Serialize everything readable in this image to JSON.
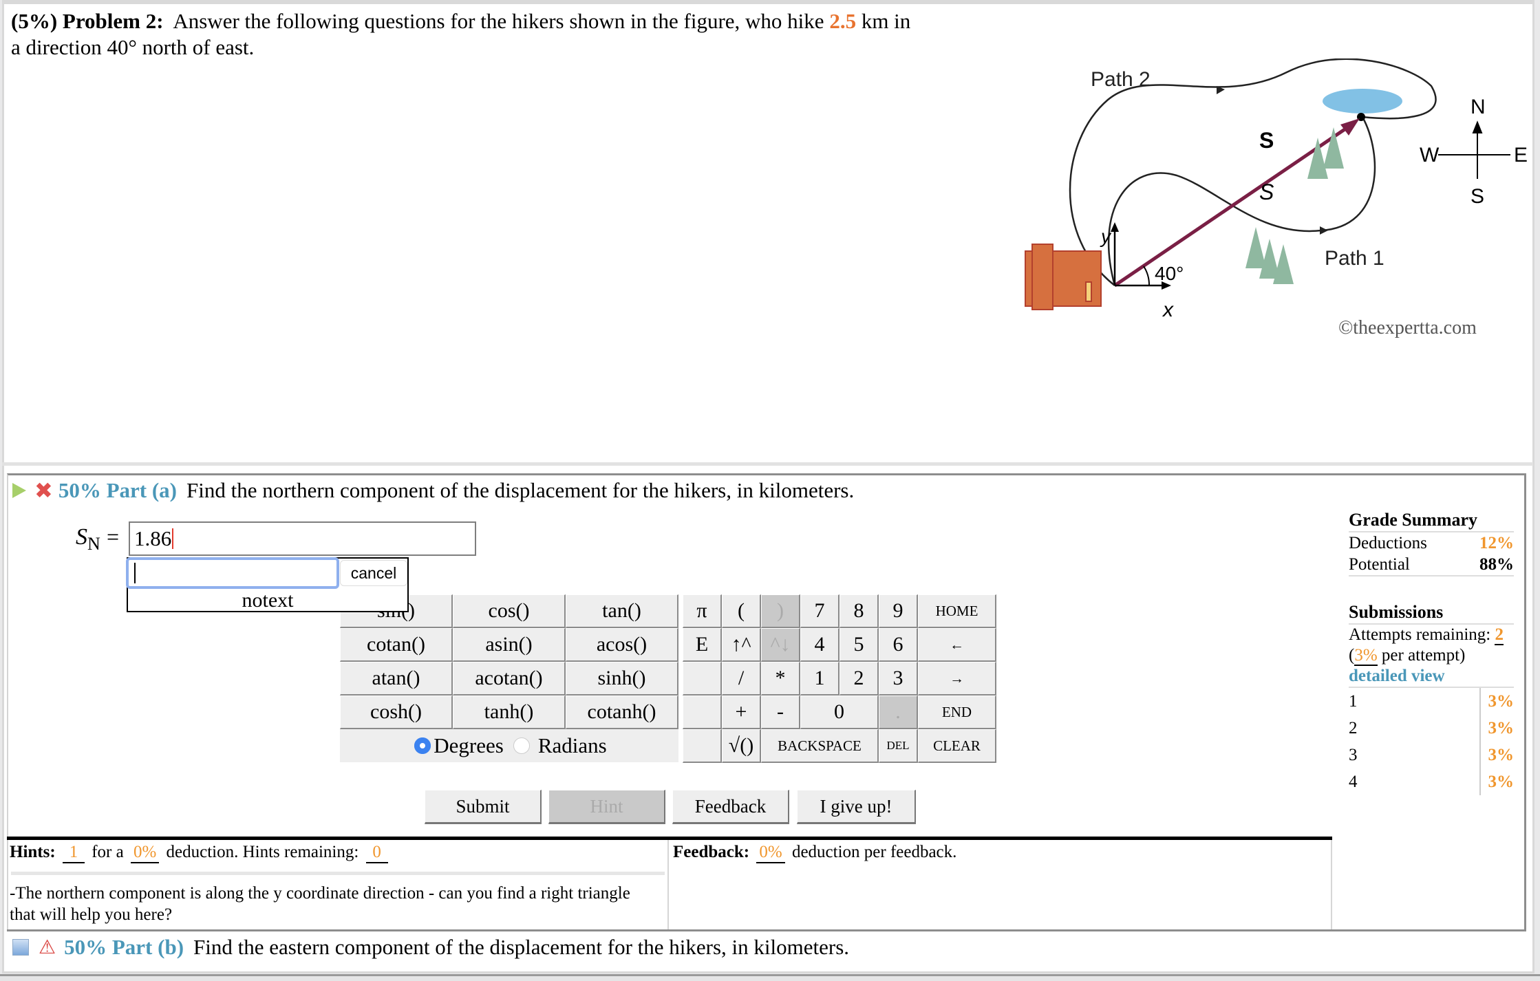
{
  "problem": {
    "prefix": "(5%)",
    "label": "Problem 2:",
    "text_before": "Answer the following questions for the hikers shown in the figure, who hike",
    "distance": "2.5",
    "text_after": "km in",
    "line2": "a direction 40° north of east."
  },
  "figure": {
    "path2_label": "Path 2",
    "path1_label": "Path 1",
    "s_bold": "S",
    "s_italic": "S",
    "angle_label": "40°",
    "x_label": "x",
    "y_label": "y",
    "compass": {
      "n": "N",
      "s": "S",
      "e": "E",
      "w": "W"
    },
    "watermark": "©theexpertta.com"
  },
  "part_a": {
    "percent": "50% Part (a)",
    "question": "Find the northern component of the displacement for the hikers, in kilometers.",
    "variable": "S",
    "subscript": "N",
    "equals": "=",
    "answer_value": "1.86",
    "popup": {
      "cancel_label": "cancel",
      "notext_label": "notext"
    }
  },
  "keypad": {
    "functions": [
      [
        "sin()",
        "cos()",
        "tan()"
      ],
      [
        "cotan()",
        "asin()",
        "acos()"
      ],
      [
        "atan()",
        "acotan()",
        "sinh()"
      ],
      [
        "cosh()",
        "tanh()",
        "cotanh()"
      ]
    ],
    "angle_mode": {
      "degrees": "Degrees",
      "radians": "Radians",
      "selected": "Degrees"
    },
    "keys": {
      "pi": "π",
      "lparen": "(",
      "rparen": ")",
      "e": "E",
      "up": "↑^",
      "down": "^↓",
      "slash": "/",
      "star": "*",
      "plus": "+",
      "minus": "-",
      "sqrt": "√()",
      "n7": "7",
      "n8": "8",
      "n9": "9",
      "n4": "4",
      "n5": "5",
      "n6": "6",
      "n1": "1",
      "n2": "2",
      "n3": "3",
      "n0": "0",
      "dot": ".",
      "home": "HOME",
      "left": "←",
      "right": "→",
      "end": "END",
      "backspace": "BACKSPACE",
      "del": "DEL",
      "clear": "CLEAR"
    }
  },
  "actions": {
    "submit": "Submit",
    "hint": "Hint",
    "feedback": "Feedback",
    "give_up": "I give up!"
  },
  "hints": {
    "label": "Hints:",
    "count": "1",
    "for_a": "for a",
    "deduction": "0%",
    "deduction_text": "deduction. Hints remaining:",
    "remaining": "0",
    "text": "-The northern component is along the y coordinate direction - can you find a right triangle that will help you here?"
  },
  "feedback": {
    "label": "Feedback:",
    "deduction": "0%",
    "text": "deduction per feedback."
  },
  "grade_summary": {
    "title": "Grade Summary",
    "deductions_label": "Deductions",
    "deductions_value": "12%",
    "potential_label": "Potential",
    "potential_value": "88%"
  },
  "submissions": {
    "title": "Submissions",
    "attempts_label": "Attempts remaining:",
    "attempts_value": "2",
    "per_attempt_value": "3%",
    "per_attempt_text": "per attempt)",
    "detailed_view": "detailed view",
    "list": [
      {
        "n": "1",
        "value": "3%"
      },
      {
        "n": "2",
        "value": "3%"
      },
      {
        "n": "3",
        "value": "3%"
      },
      {
        "n": "4",
        "value": "3%"
      }
    ]
  },
  "part_b": {
    "percent": "50% Part (b)",
    "question": "Find the eastern component of the displacement for the hikers, in kilometers."
  }
}
